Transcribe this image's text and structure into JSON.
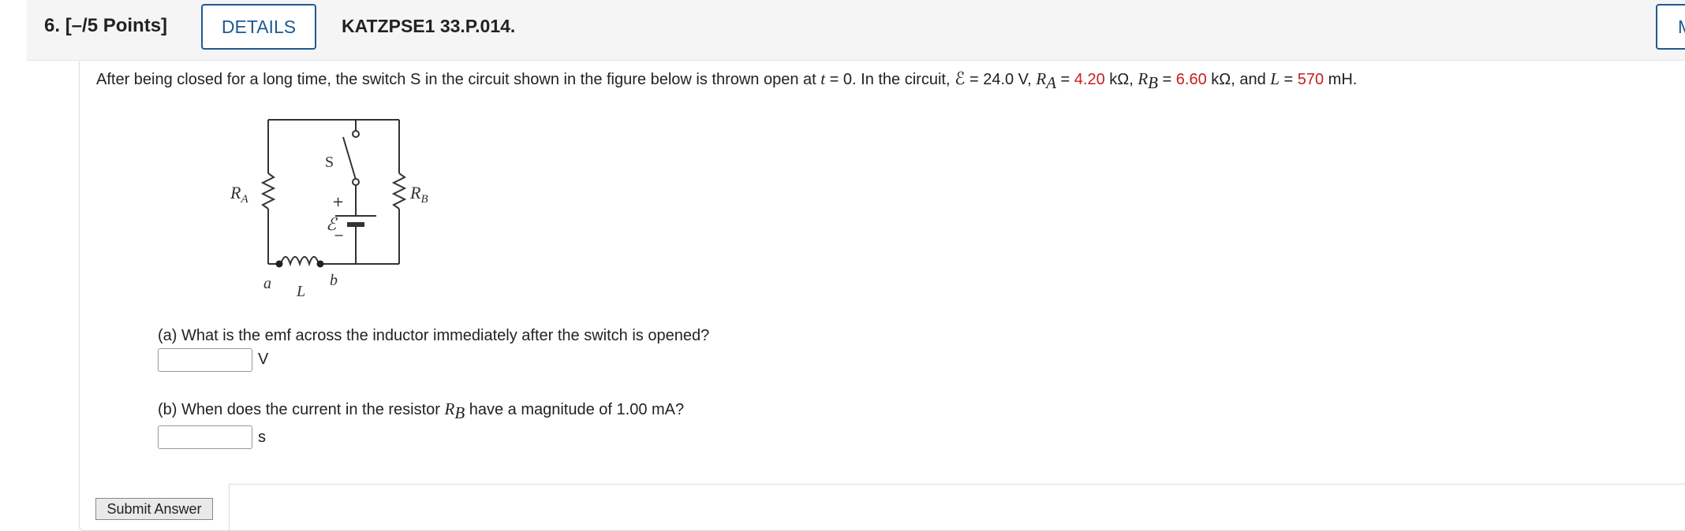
{
  "header": {
    "question_number": "6.",
    "points": "[–/5 Points]",
    "details_label": "DETAILS",
    "question_id": "KATZPSE1 33.P.014.",
    "my_label": "MY"
  },
  "prompt": {
    "intro": "After being closed for a long time, the switch S in the circuit shown in the figure below is thrown open at ",
    "t_var": "t",
    "t_eq": " = 0.  In the circuit, ",
    "emf_symbol": "ℰ",
    "emf_eq": " = 24.0 V,  ",
    "ra_var": "R",
    "ra_sub": "A",
    "ra_eq": " = ",
    "ra_value": "4.20",
    "ra_unit": " kΩ,  ",
    "rb_var": "R",
    "rb_sub": "B",
    "rb_eq": " = ",
    "rb_value": "6.60",
    "rb_unit": " kΩ,  and  ",
    "l_var": "L",
    "l_eq": " = ",
    "l_value": "570",
    "l_unit": " mH."
  },
  "figure": {
    "label_ra": "R",
    "label_ra_sub": "A",
    "label_rb": "R",
    "label_rb_sub": "B",
    "label_s": "S",
    "label_plus": "+",
    "label_minus": "−",
    "label_emf": "ℰ",
    "label_a": "a",
    "label_b": "b",
    "label_l": "L"
  },
  "part_a": {
    "question": "(a) What is the emf across the inductor immediately after the switch is opened?",
    "unit": "V",
    "value": ""
  },
  "part_b": {
    "question_pre": "(b) When does the current in the resistor ",
    "var": "R",
    "sub": "B",
    "question_post": " have a magnitude of 1.00 mA?",
    "unit": "s",
    "value": ""
  },
  "submit_label": "Submit Answer",
  "colors": {
    "accent": "#1d5a93",
    "given_value": "#c81e1e"
  }
}
